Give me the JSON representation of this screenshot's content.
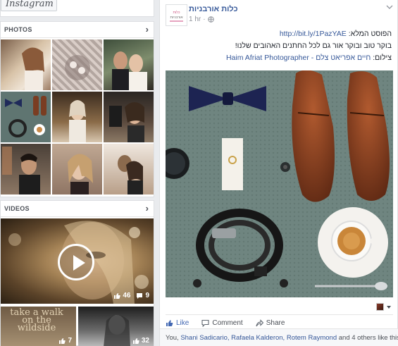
{
  "instagram": {
    "label": "Instagram"
  },
  "photos_panel": {
    "title": "PHOTOS",
    "chevron": "›"
  },
  "videos_panel": {
    "title": "VIDEOS",
    "chevron": "›",
    "main_video": {
      "likes": "46",
      "comments": "9"
    },
    "small_videos": [
      {
        "caption": "take a walk on the wildside",
        "likes": "7"
      },
      {
        "likes": "32"
      }
    ]
  },
  "post": {
    "page_name": "כלות אורבניות",
    "time": "1 hr",
    "separator": "·",
    "full_post_label": "הפוסט המלא:",
    "full_post_link": "http://bit.ly/1PazYAE",
    "greeting": "בוקר טוב ובוקר אור גם לכל החתנים האהובים שלנו!",
    "credit_label": "צילום:",
    "credit_name": "חיים אפריאט צלם - Haim Afriat Photographer",
    "actions": {
      "like": "Like",
      "comment": "Comment",
      "share": "Share"
    },
    "likes_line": {
      "prefix": "You,",
      "names": [
        "Shani Sadicario,",
        "Rafaela Kalderon,",
        "Rotem Raymond"
      ],
      "others": "and 4 others like this."
    }
  },
  "colors": {
    "fb_blue": "#4267b2",
    "link": "#365899",
    "muted": "#90949c"
  },
  "icons": [
    "chevron-right-icon",
    "play-icon",
    "thumbs-up-icon",
    "comment-icon",
    "share-icon",
    "globe-icon",
    "caret-down-icon"
  ]
}
